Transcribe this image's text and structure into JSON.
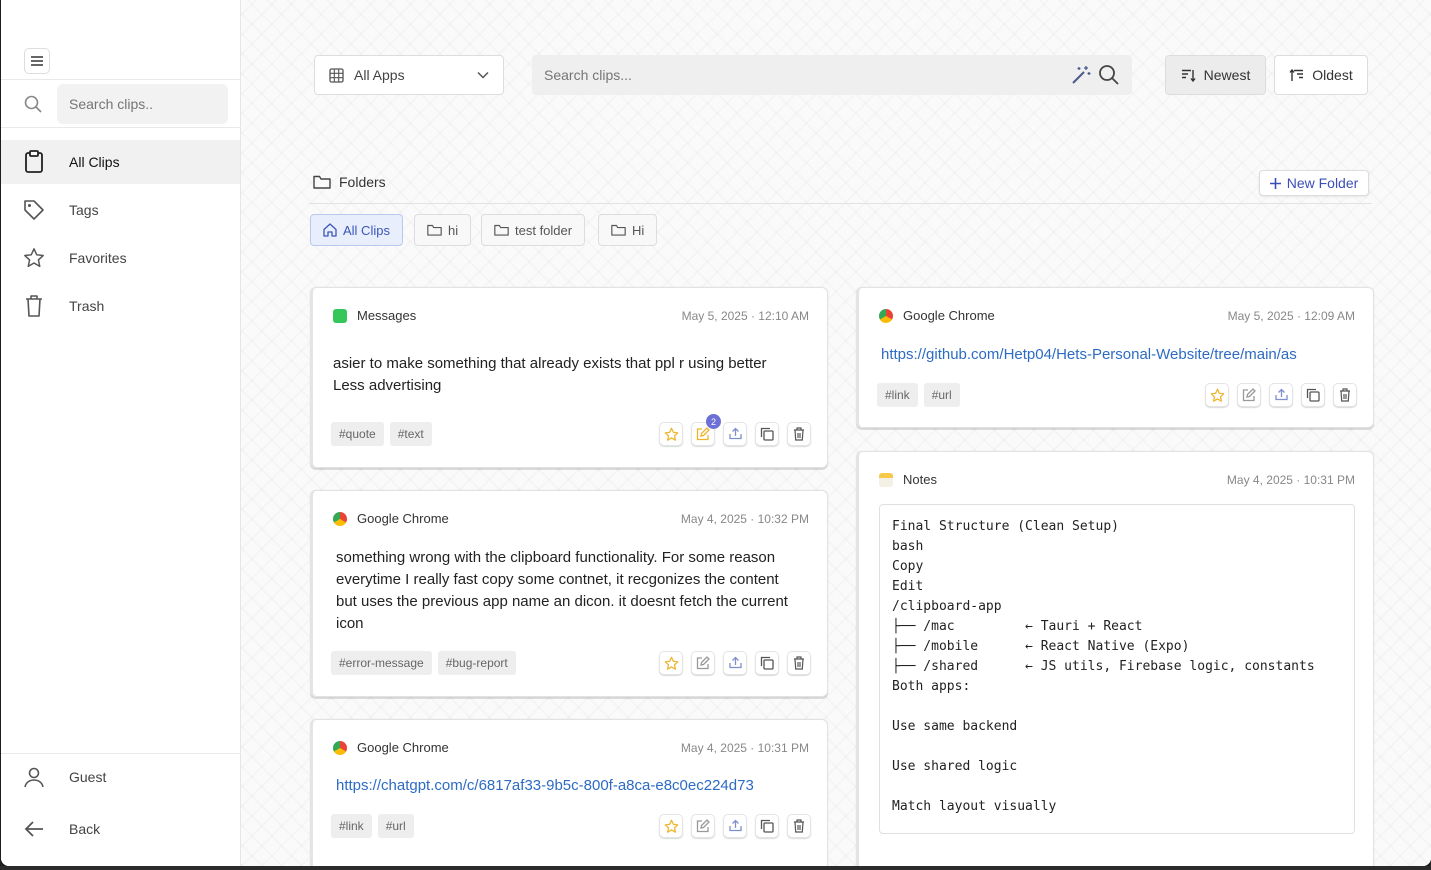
{
  "sidebar": {
    "search_placeholder": "Search clips..",
    "items": [
      {
        "label": "All Clips",
        "icon": "clipboard-icon"
      },
      {
        "label": "Tags",
        "icon": "tag-icon"
      },
      {
        "label": "Favorites",
        "icon": "star-icon"
      },
      {
        "label": "Trash",
        "icon": "trash-icon"
      }
    ],
    "user_label": "Guest",
    "back_label": "Back"
  },
  "toolbar": {
    "app_filter": "All Apps",
    "search_placeholder": "Search clips...",
    "sort_newest": "Newest",
    "sort_oldest": "Oldest",
    "active_sort": "Newest"
  },
  "folders": {
    "title": "Folders",
    "new_folder_label": "New Folder",
    "chips": [
      "All Clips",
      "hi",
      "test folder",
      "Hi"
    ],
    "active": "All Clips"
  },
  "clips": [
    {
      "app": "Messages",
      "date": "May 5, 2025 · 12:10 AM",
      "text": [
        "asier to make something that already exists that ppl r using better",
        "Less advertising"
      ],
      "tags": [
        "#quote",
        "#text"
      ],
      "edit_badge": "2"
    },
    {
      "app": "Google Chrome",
      "date": "May 4, 2025 · 10:32 PM",
      "text": [
        "something wrong with the clipboard functionality. For some reason everytime I really fast copy some contnet, it recgonizes the content but uses the previous app name an dicon. it doesnt fetch the current icon"
      ],
      "tags": [
        "#error-message",
        "#bug-report"
      ]
    },
    {
      "app": "Google Chrome",
      "date": "May 4, 2025 · 10:31 PM",
      "link": "https://chatgpt.com/c/6817af33-9b5c-800f-a8ca-e8c0ec224d73",
      "tags": [
        "#link",
        "#url"
      ]
    },
    {
      "app": "Google Chrome",
      "date": "May 5, 2025 · 12:09 AM",
      "link": "https://github.com/Hetp04/Hets-Personal-Website/tree/main/as",
      "tags": [
        "#link",
        "#url"
      ]
    },
    {
      "app": "Notes",
      "date": "May 4, 2025 · 10:31 PM",
      "code": "Final Structure (Clean Setup)\nbash\nCopy\nEdit\n/clipboard-app\n├── /mac         ← Tauri + React\n├── /mobile      ← React Native (Expo)\n├── /shared      ← JS utils, Firebase logic, constants\nBoth apps:\n\nUse same backend\n\nUse shared logic\n\nMatch layout visually"
    }
  ],
  "colors": {
    "accent": "#3b4fb8",
    "link": "#2d6bc4",
    "star": "#f0b429",
    "badge": "#6b6fd6"
  }
}
